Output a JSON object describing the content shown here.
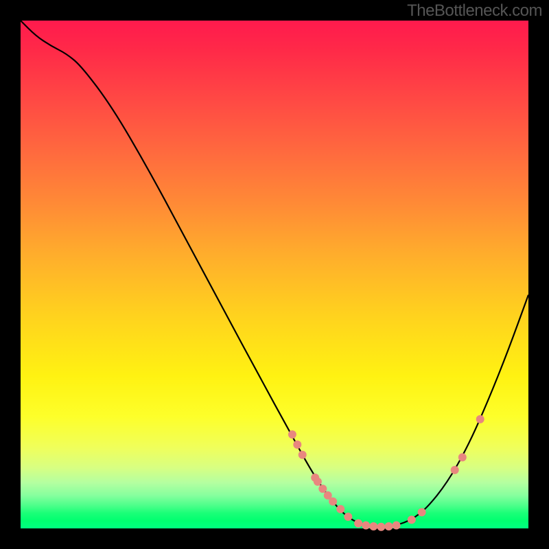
{
  "watermark": "TheBottleneck.com",
  "colors": {
    "curve_stroke": "#000000",
    "marker_fill": "#e8877f"
  },
  "chart_data": {
    "type": "line",
    "title": "",
    "xlabel": "",
    "ylabel": "",
    "xlim": [
      0,
      100
    ],
    "ylim": [
      0,
      100
    ],
    "grid": false,
    "curve": [
      {
        "x": 0,
        "y": 100
      },
      {
        "x": 3,
        "y": 97
      },
      {
        "x": 6,
        "y": 95
      },
      {
        "x": 9,
        "y": 93.5
      },
      {
        "x": 12,
        "y": 91
      },
      {
        "x": 18,
        "y": 83
      },
      {
        "x": 25,
        "y": 71
      },
      {
        "x": 32,
        "y": 58
      },
      {
        "x": 40,
        "y": 43
      },
      {
        "x": 47,
        "y": 30
      },
      {
        "x": 53,
        "y": 19
      },
      {
        "x": 58,
        "y": 10
      },
      {
        "x": 62,
        "y": 4.5
      },
      {
        "x": 65,
        "y": 1.7
      },
      {
        "x": 68,
        "y": 0.6
      },
      {
        "x": 71,
        "y": 0.3
      },
      {
        "x": 74,
        "y": 0.6
      },
      {
        "x": 77,
        "y": 1.7
      },
      {
        "x": 80,
        "y": 4
      },
      {
        "x": 84,
        "y": 9
      },
      {
        "x": 88,
        "y": 16
      },
      {
        "x": 92,
        "y": 25
      },
      {
        "x": 96,
        "y": 35
      },
      {
        "x": 100,
        "y": 46
      }
    ],
    "markers": [
      {
        "x": 53.5,
        "y": 18.5
      },
      {
        "x": 54.5,
        "y": 16.5
      },
      {
        "x": 55.5,
        "y": 14.5
      },
      {
        "x": 58,
        "y": 10
      },
      {
        "x": 58.5,
        "y": 9.2
      },
      {
        "x": 59.5,
        "y": 7.8
      },
      {
        "x": 60.5,
        "y": 6.5
      },
      {
        "x": 61.5,
        "y": 5.3
      },
      {
        "x": 63,
        "y": 3.8
      },
      {
        "x": 64.5,
        "y": 2.3
      },
      {
        "x": 66.5,
        "y": 1
      },
      {
        "x": 68,
        "y": 0.6
      },
      {
        "x": 69.5,
        "y": 0.4
      },
      {
        "x": 71,
        "y": 0.3
      },
      {
        "x": 72.5,
        "y": 0.4
      },
      {
        "x": 74,
        "y": 0.6
      },
      {
        "x": 77,
        "y": 1.7
      },
      {
        "x": 79,
        "y": 3.2
      },
      {
        "x": 85.5,
        "y": 11.5
      },
      {
        "x": 87,
        "y": 14
      },
      {
        "x": 90.5,
        "y": 21.5
      }
    ],
    "legend": null
  }
}
